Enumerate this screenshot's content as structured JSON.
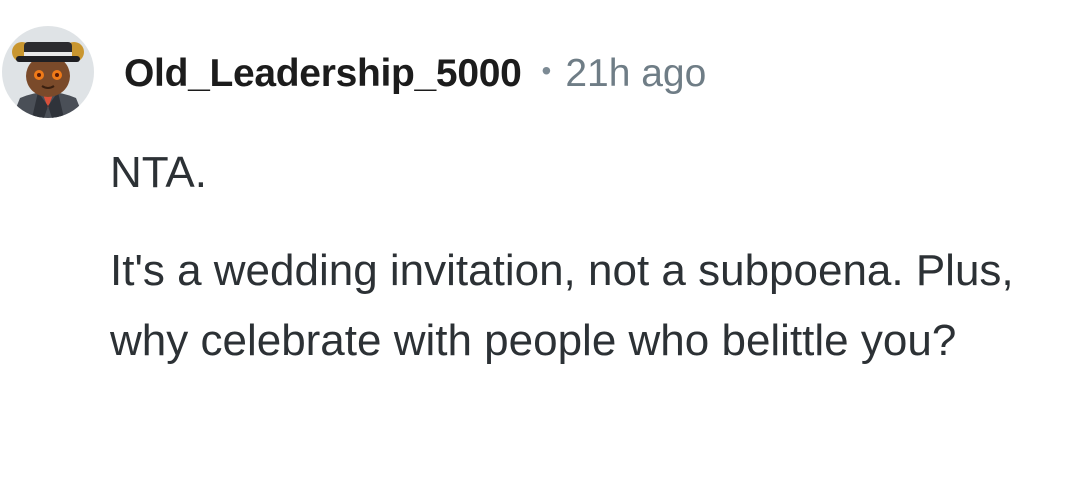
{
  "comment": {
    "author": "Old_Leadership_5000",
    "separator": "•",
    "timestamp": "21h ago",
    "avatar_icon": "user-avatar-icon",
    "paragraphs": [
      "NTA.",
      "It's a wedding invitation, not a subpoena. Plus, why celebrate with people who belittle you?"
    ]
  },
  "colors": {
    "username": "#1c1c1c",
    "meta": "#6f7d86",
    "body": "#2c3135",
    "background": "#ffffff"
  }
}
